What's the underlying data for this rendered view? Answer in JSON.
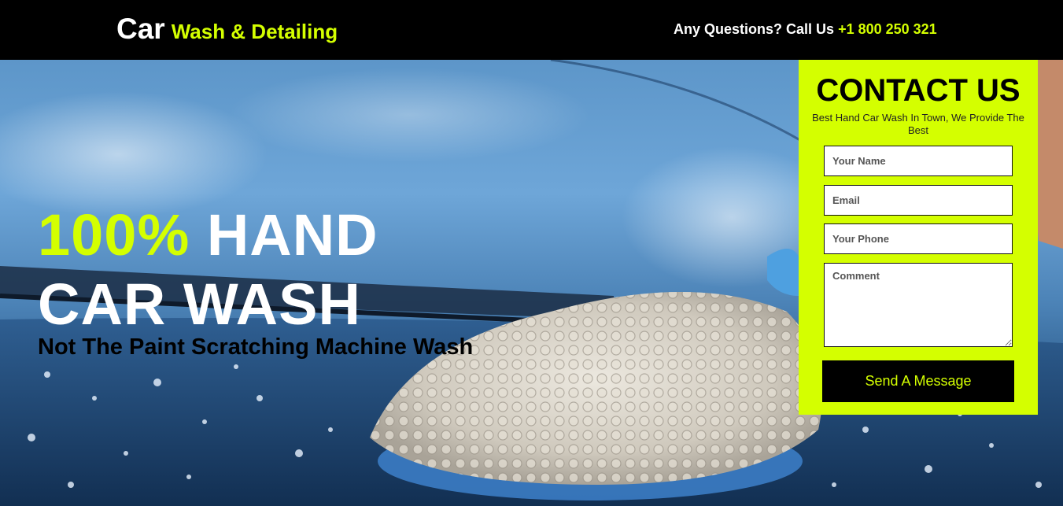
{
  "header": {
    "logo_main": "Car",
    "logo_sub": "Wash & Detailing",
    "phone_prefix": "Any Questions? Call Us",
    "phone_number": "+1 800 250 321"
  },
  "hero": {
    "headline_accent": "100%",
    "headline_rest": "HAND",
    "headline_line2": "CAR WASH",
    "tagline": "Not The Paint Scratching Machine Wash"
  },
  "contact": {
    "title": "CONTACT US",
    "subtitle": "Best Hand Car Wash In Town, We Provide The Best",
    "name_placeholder": "Your Name",
    "email_placeholder": "Email",
    "phone_placeholder": "Your Phone",
    "comment_placeholder": "Comment",
    "submit_label": "Send A Message"
  },
  "colors": {
    "accent": "#d4ff00",
    "header_bg": "#000000",
    "text_light": "#ffffff"
  }
}
